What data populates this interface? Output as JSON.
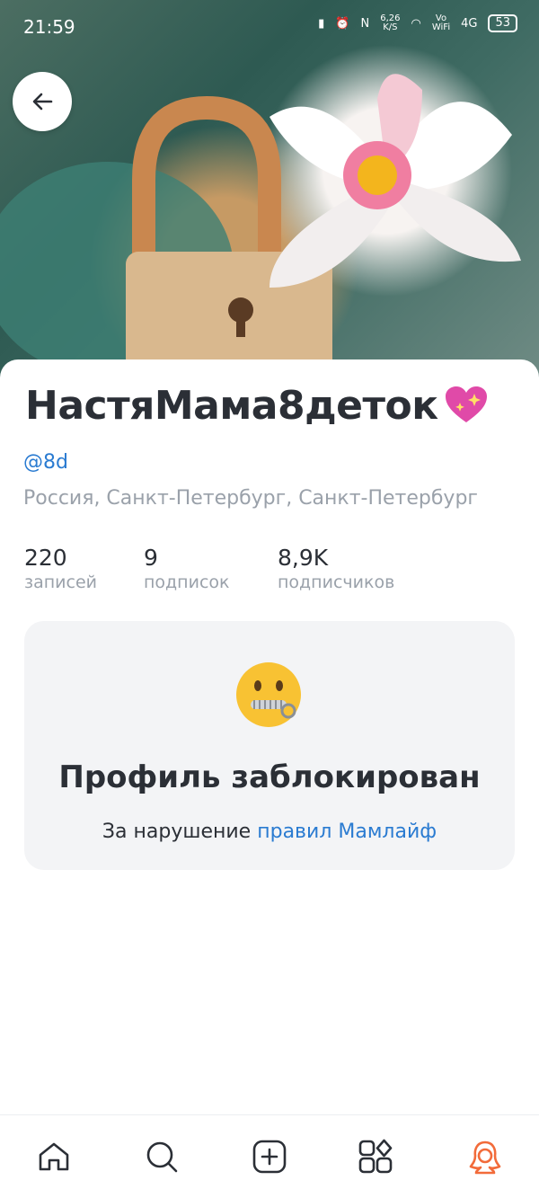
{
  "status_bar": {
    "time": "21:59",
    "speed": "6,26",
    "speed_unit": "K/S",
    "vo": "Vo",
    "wifi": "WiFi",
    "network": "4G",
    "battery": "53"
  },
  "profile": {
    "name": "НастяМама8деток",
    "username": "@8d",
    "location": "Россия, Санкт-Петербург, Санкт-Петербург",
    "stats": [
      {
        "value": "220",
        "label": "записей"
      },
      {
        "value": "9",
        "label": "подписок"
      },
      {
        "value": "8,9K",
        "label": "подписчиков"
      }
    ]
  },
  "blocked": {
    "title": "Профиль заблокирован",
    "reason_prefix": "За нарушение",
    "reason_link": "правил Мамлайф"
  },
  "nav": {
    "items": [
      "home-icon",
      "search-icon",
      "add-icon",
      "apps-icon",
      "profile-icon"
    ],
    "active_color": "#f26b3a"
  },
  "colors": {
    "link": "#2a7bd1",
    "muted": "#9aa1aa",
    "text": "#2b2f36"
  }
}
